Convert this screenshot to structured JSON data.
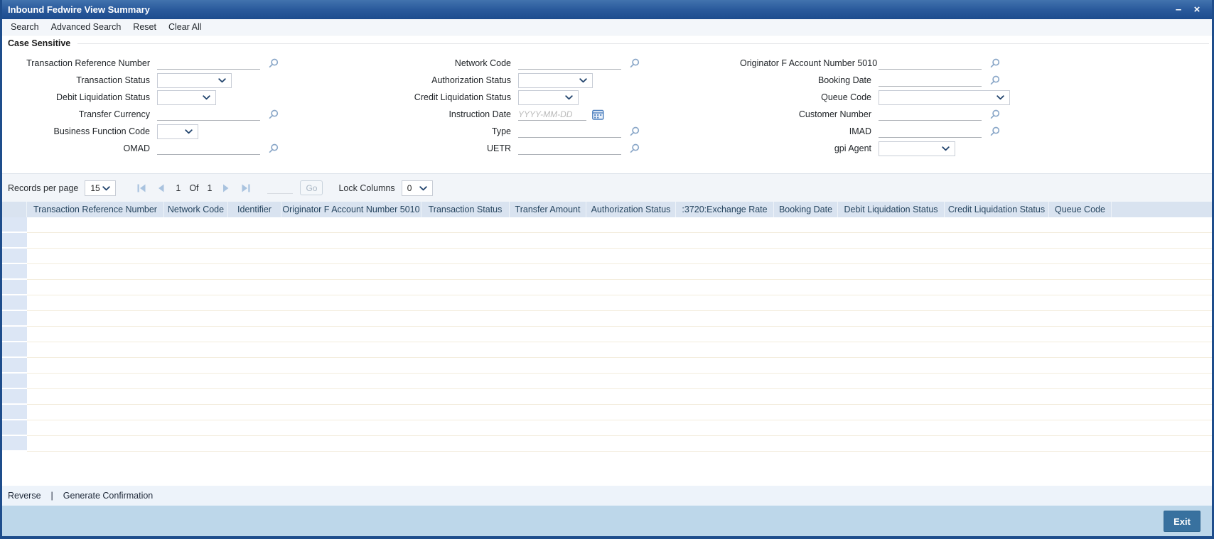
{
  "window": {
    "title": "Inbound Fedwire View Summary",
    "controls": {
      "minimize": "–",
      "close": "×"
    }
  },
  "toolbar": {
    "items": [
      {
        "label": "Search"
      },
      {
        "label": "Advanced Search"
      },
      {
        "label": "Reset"
      },
      {
        "label": "Clear All"
      }
    ]
  },
  "filters": {
    "section_label": "Case Sensitive",
    "instruction_date_placeholder": "YYYY-MM-DD",
    "col1": [
      {
        "label": "Transaction Reference Number",
        "widget": "lov",
        "value": ""
      },
      {
        "label": "Transaction Status",
        "widget": "select",
        "value": ""
      },
      {
        "label": "Debit Liquidation Status",
        "widget": "select",
        "value": ""
      },
      {
        "label": "Transfer Currency",
        "widget": "lov",
        "value": ""
      },
      {
        "label": "Business Function Code",
        "widget": "select",
        "value": ""
      },
      {
        "label": "OMAD",
        "widget": "lov",
        "value": ""
      }
    ],
    "col2": [
      {
        "label": "Network Code",
        "widget": "lov",
        "value": ""
      },
      {
        "label": "Authorization Status",
        "widget": "select",
        "value": ""
      },
      {
        "label": "Credit Liquidation Status",
        "widget": "select",
        "value": ""
      },
      {
        "label": "Instruction Date",
        "widget": "date",
        "value": ""
      },
      {
        "label": "Type",
        "widget": "lov",
        "value": ""
      },
      {
        "label": "UETR",
        "widget": "lov",
        "value": ""
      }
    ],
    "col3": [
      {
        "label": "Originator F Account Number 5010",
        "widget": "lov",
        "value": ""
      },
      {
        "label": "Booking Date",
        "widget": "lov",
        "value": ""
      },
      {
        "label": "Queue Code",
        "widget": "select",
        "value": ""
      },
      {
        "label": "Customer Number",
        "widget": "lov",
        "value": ""
      },
      {
        "label": "IMAD",
        "widget": "lov",
        "value": ""
      },
      {
        "label": "gpi Agent",
        "widget": "select",
        "value": ""
      }
    ]
  },
  "pagination": {
    "records_per_page_label": "Records per page",
    "records_per_page_value": "15",
    "page": "1",
    "of_label": "Of",
    "total_pages": "1",
    "goto_value": "",
    "go_label": "Go",
    "lock_columns_label": "Lock Columns",
    "lock_columns_value": "0"
  },
  "table": {
    "headers": [
      "Transaction Reference Number",
      "Network Code",
      "Identifier",
      "Originator F Account Number 5010",
      "Transaction Status",
      "Transfer Amount",
      "Authorization Status",
      ":3720:Exchange Rate",
      "Booking Date",
      "Debit Liquidation Status",
      "Credit Liquidation Status",
      "Queue Code"
    ],
    "rows": [],
    "visible_row_slots": 15
  },
  "actions": {
    "reverse_label": "Reverse",
    "separator": "|",
    "generate_confirmation_label": "Generate Confirmation"
  },
  "footer": {
    "exit_label": "Exit"
  },
  "icons": {
    "lov": "magnifier-icon",
    "date": "calendar-icon",
    "dropdown": "chevron-down-icon",
    "pager": [
      "first-page-icon",
      "previous-page-icon",
      "next-page-icon",
      "last-page-icon"
    ],
    "window": [
      "minimize-icon",
      "close-icon"
    ]
  },
  "colors": {
    "titlebar_top": "#4273ae",
    "titlebar_bottom": "#1d4c8e",
    "table_header_bg": "#d9e3f0",
    "gutter_cell_bg": "#dce6f5",
    "row_separator": "#f3ecdc",
    "records_bar_bg": "#f2f5f9",
    "actions_strip_bg": "#edf3fa",
    "footer_band_bg": "#bdd7ea",
    "exit_button_bg": "#38719f",
    "accent_icon": "#8aa7c8"
  }
}
